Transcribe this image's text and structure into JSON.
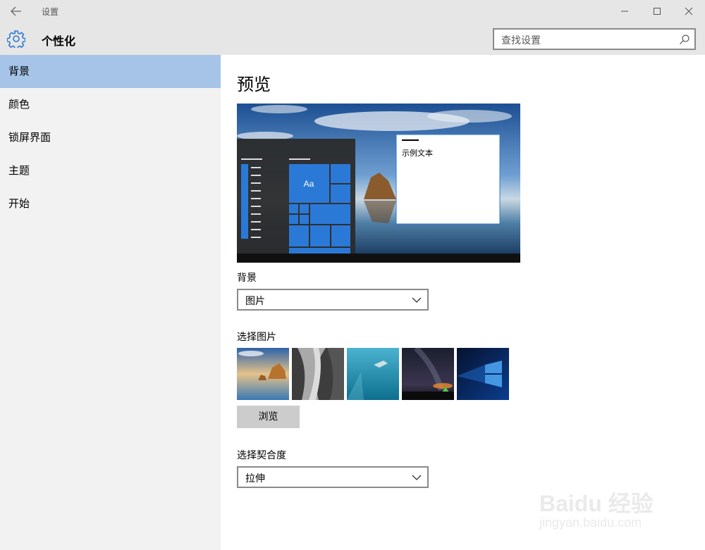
{
  "window": {
    "title": "设置",
    "controls": [
      "minimize",
      "maximize",
      "close"
    ]
  },
  "header": {
    "icon": "gear-icon",
    "title": "个性化",
    "search_placeholder": "查找设置"
  },
  "sidebar": {
    "items": [
      {
        "label": "背景",
        "selected": true
      },
      {
        "label": "颜色",
        "selected": false
      },
      {
        "label": "锁屏界面",
        "selected": false
      },
      {
        "label": "主题",
        "selected": false
      },
      {
        "label": "开始",
        "selected": false
      }
    ]
  },
  "main": {
    "title": "预览",
    "preview": {
      "tile_label": "Aa",
      "sample_text": "示例文本"
    },
    "background": {
      "label": "背景",
      "value": "图片"
    },
    "choose_picture": {
      "label": "选择图片",
      "thumbnails": [
        "beach-rock-photo",
        "rock-cliff-photo",
        "underwater-swimmer-photo",
        "night-sky-tent-photo",
        "windows-logo-photo"
      ]
    },
    "browse_label": "浏览",
    "fit": {
      "label": "选择契合度",
      "value": "拉伸"
    }
  },
  "watermark": {
    "brand": "Baidu 经验",
    "url": "jingyan.baidu.com"
  },
  "colors": {
    "titlebar": "#e6e6e6",
    "sidebar": "#f2f2f2",
    "selected": "#a6c4e8",
    "accent": "#2b79d6"
  }
}
